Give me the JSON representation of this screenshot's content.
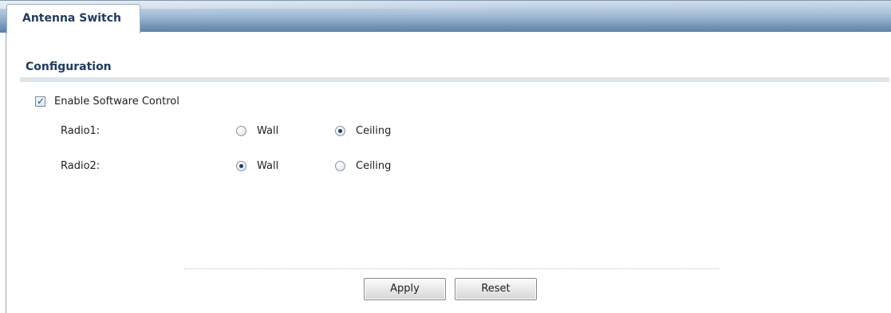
{
  "tabs": [
    {
      "label": "Antenna Switch",
      "active": true
    }
  ],
  "section": {
    "title": "Configuration"
  },
  "software_control": {
    "label": "Enable Software Control",
    "checked": true
  },
  "radios": [
    {
      "label": "Radio1:",
      "options": [
        {
          "label": "Wall",
          "selected": false
        },
        {
          "label": "Ceiling",
          "selected": true
        }
      ]
    },
    {
      "label": "Radio2:",
      "options": [
        {
          "label": "Wall",
          "selected": true
        },
        {
          "label": "Ceiling",
          "selected": false
        }
      ]
    }
  ],
  "buttons": {
    "apply_label": "Apply",
    "reset_label": "Reset"
  },
  "colors": {
    "tab_text": "#1f3b63",
    "tabbar_dark": "#5b80a6",
    "section_rule": "#dfe5ec"
  }
}
